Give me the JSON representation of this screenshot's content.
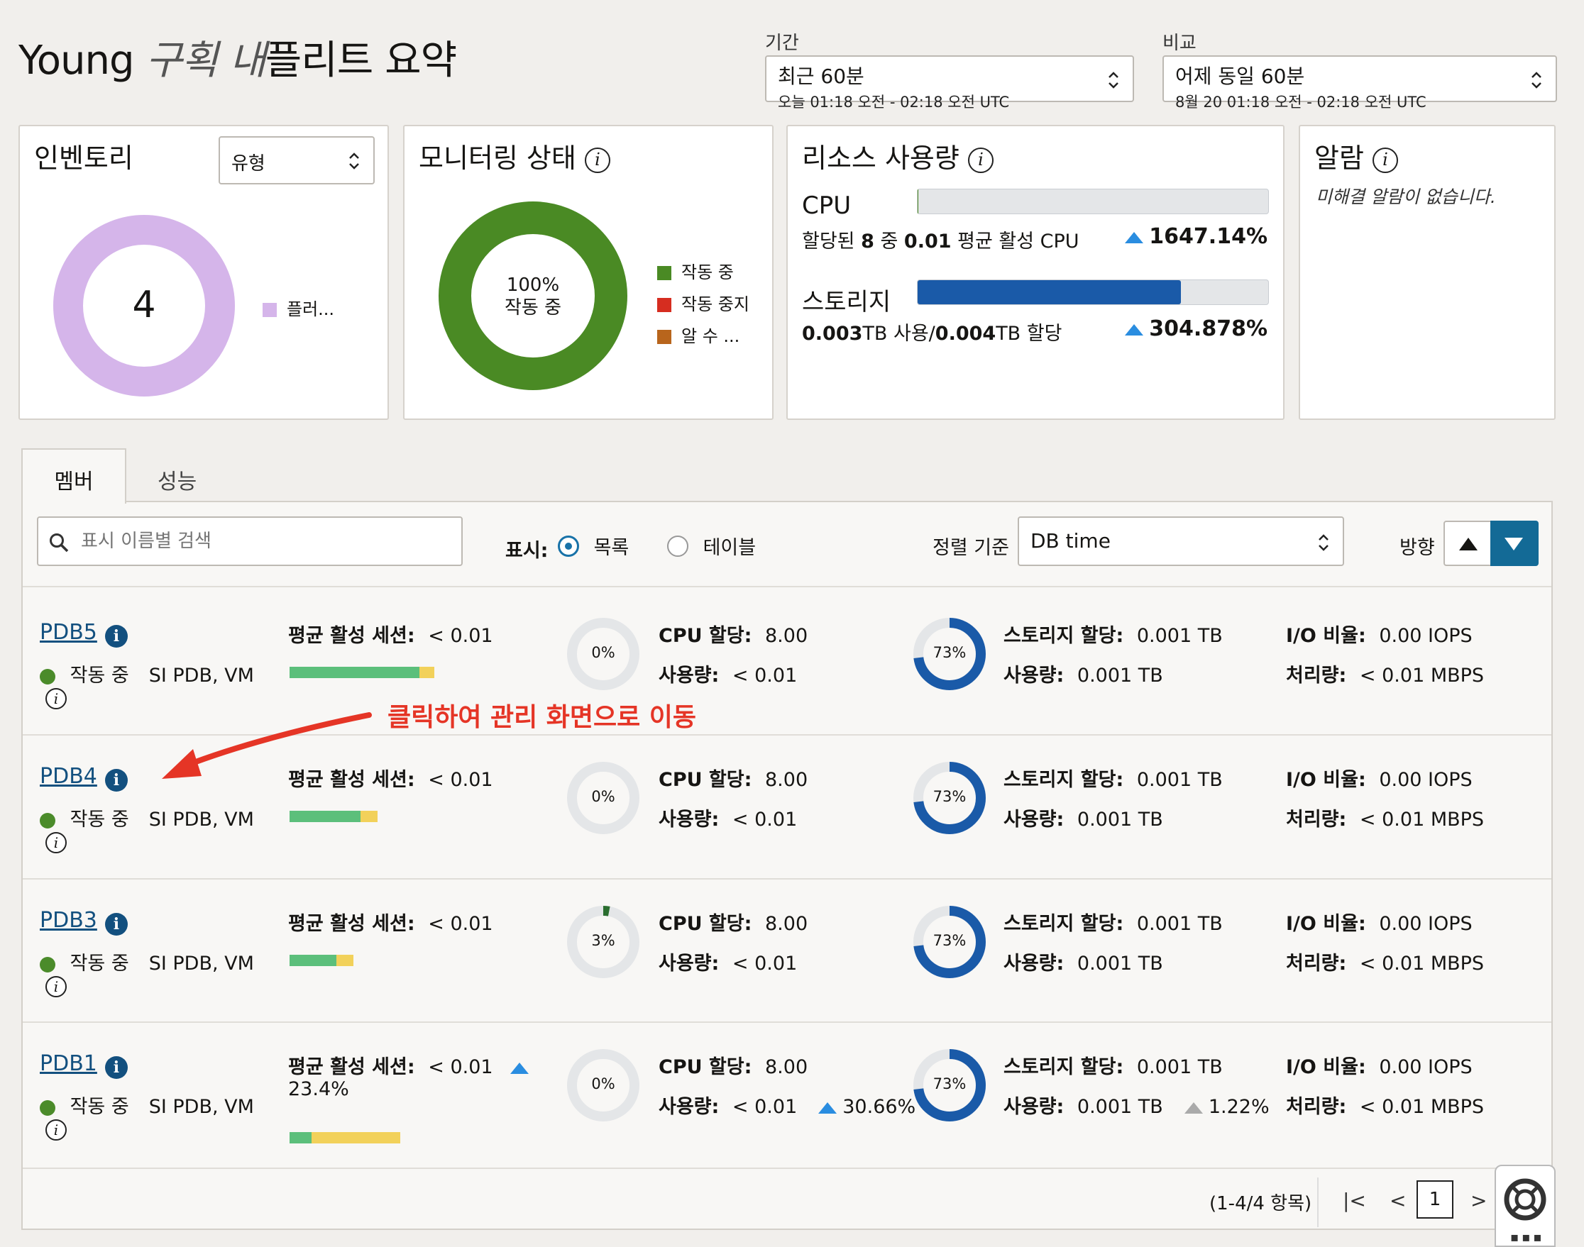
{
  "header": {
    "title_part1": "Young",
    "title_part2": "구획 내",
    "title_part3": "플리트 요약",
    "period": {
      "label": "기간",
      "value": "최근 60분",
      "range": "오늘 01:18 오전 - 02:18 오전 UTC"
    },
    "compare": {
      "label": "비교",
      "value": "어제 동일 60분",
      "range": "8월 20 01:18 오전 - 02:18 오전 UTC"
    }
  },
  "inventory": {
    "title": "인벤토리",
    "select_value": "유형",
    "count": "4",
    "legend": "플러...",
    "color": "#d5b5ea"
  },
  "monitoring": {
    "title": "모니터링 상태",
    "center_pct": "100%",
    "center_label": "작동 중",
    "legend": [
      {
        "label": "작동 중",
        "color": "#4a8a24"
      },
      {
        "label": "작동 중지",
        "color": "#d62d20"
      },
      {
        "label": "알 수 ...",
        "color": "#b8651c"
      }
    ]
  },
  "resource": {
    "title": "리소스 사용량",
    "cpu": {
      "name": "CPU",
      "pre": "할당된 ",
      "alloc": "8",
      "mid": " 중 ",
      "used": "0.01",
      "post": " 평균 활성 CPU",
      "change": "1647.14%",
      "fill": 0.002
    },
    "storage": {
      "name": "스토리지",
      "used": "0.003",
      "used_unit": "TB 사용/",
      "alloc": "0.004",
      "alloc_unit": "TB 할당",
      "change": "304.878%",
      "fill": 0.75
    }
  },
  "alarms": {
    "title": "알람",
    "message": "미해결 알람이 없습니다."
  },
  "tabs": [
    "멤버",
    "성능"
  ],
  "toolbar": {
    "search_placeholder": "표시 이름별 검색",
    "view_label": "표시:",
    "view_list": "목록",
    "view_table": "테이블",
    "sort_label": "정렬 기준",
    "sort_value": "DB time",
    "direction_label": "방향"
  },
  "labels": {
    "sessions": "평균 활성 세션:",
    "cpu_alloc": "CPU 할당:",
    "usage": "사용량:",
    "storage_alloc": "스토리지 할당:",
    "io": "I/O 비율:",
    "throughput": "처리량:"
  },
  "members": [
    {
      "name": "PDB5",
      "status": "작동 중",
      "type": "SI PDB, VM",
      "sessions": "< 0.01",
      "session_change": "",
      "green": 0.53,
      "yellow": 0.06,
      "cpu_pct": "0%",
      "cpu_frac": 0,
      "cpu_alloc": "8.00",
      "cpu_used": "< 0.01",
      "cpu_change": "",
      "st_pct": "73%",
      "st_frac": 0.73,
      "st_alloc": "0.001 TB",
      "st_used": "0.001 TB",
      "st_change": "",
      "io": "0.00 IOPS",
      "tp": "< 0.01 MBPS"
    },
    {
      "name": "PDB4",
      "status": "작동 중",
      "type": "SI PDB, VM",
      "sessions": "< 0.01",
      "session_change": "",
      "green": 0.29,
      "yellow": 0.07,
      "cpu_pct": "0%",
      "cpu_frac": 0,
      "cpu_alloc": "8.00",
      "cpu_used": "< 0.01",
      "cpu_change": "",
      "st_pct": "73%",
      "st_frac": 0.73,
      "st_alloc": "0.001 TB",
      "st_used": "0.001 TB",
      "st_change": "",
      "io": "0.00 IOPS",
      "tp": "< 0.01 MBPS"
    },
    {
      "name": "PDB3",
      "status": "작동 중",
      "type": "SI PDB, VM",
      "sessions": "< 0.01",
      "session_change": "",
      "green": 0.19,
      "yellow": 0.07,
      "cpu_pct": "3%",
      "cpu_frac": 0.03,
      "cpu_alloc": "8.00",
      "cpu_used": "< 0.01",
      "cpu_change": "",
      "st_pct": "73%",
      "st_frac": 0.73,
      "st_alloc": "0.001 TB",
      "st_used": "0.001 TB",
      "st_change": "",
      "io": "0.00 IOPS",
      "tp": "< 0.01 MBPS"
    },
    {
      "name": "PDB1",
      "status": "작동 중",
      "type": "SI PDB, VM",
      "sessions": "< 0.01",
      "session_change": "23.4%",
      "green": 0.09,
      "yellow": 0.36,
      "cpu_pct": "0%",
      "cpu_frac": 0,
      "cpu_alloc": "8.00",
      "cpu_used": "< 0.01",
      "cpu_change": "30.66%",
      "st_pct": "73%",
      "st_frac": 0.73,
      "st_alloc": "0.001 TB",
      "st_used": "0.001 TB",
      "st_change": "1.22%",
      "io": "0.00 IOPS",
      "tp": "< 0.01 MBPS"
    }
  ],
  "annotation": "클릭하여 관리 화면으로 이동",
  "pagination": {
    "summary": "(1-4/4 항목)",
    "page": "1"
  }
}
